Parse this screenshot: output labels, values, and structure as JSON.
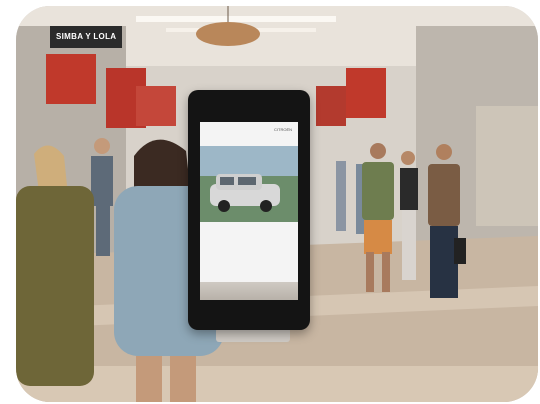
{
  "signs": {
    "store_1": "SIMBA Y LOLA"
  },
  "kiosk_ad": {
    "brand_label": "CITROËN"
  },
  "colors": {
    "floor": "#c8b6a2",
    "ceiling": "#ece6df",
    "kiosk": "#141414",
    "store_sign_red": "#c0392b"
  }
}
